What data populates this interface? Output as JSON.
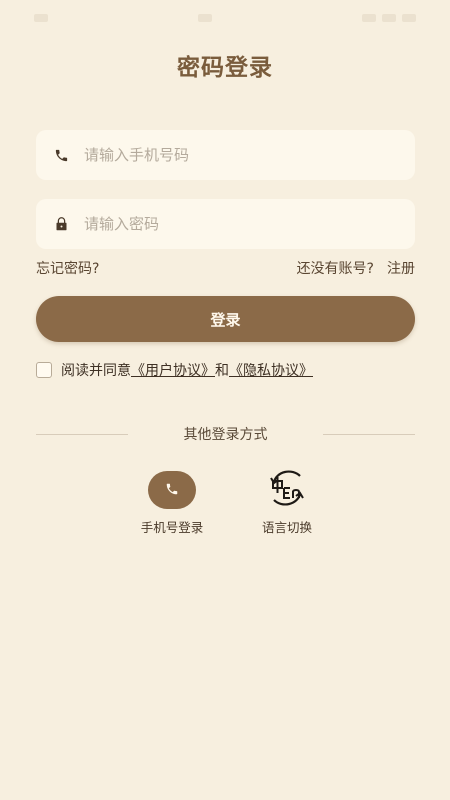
{
  "page": {
    "title": "密码登录"
  },
  "form": {
    "phone_placeholder": "请输入手机号码",
    "password_placeholder": "请输入密码",
    "forgot_password": "忘记密码?",
    "no_account": "还没有账号?",
    "register": "注册",
    "login_button": "登录"
  },
  "agreement": {
    "prefix": "阅读并同意",
    "user_agreement": "《用户协议》",
    "conjunction": "和",
    "privacy_agreement": "《隐私协议》"
  },
  "other_login": {
    "title": "其他登录方式",
    "options": [
      {
        "label": "手机号登录",
        "icon": "phone-icon"
      },
      {
        "label": "语言切换",
        "icon": "language-switch-icon"
      }
    ]
  },
  "colors": {
    "background": "#f7efdf",
    "accent": "#8b6a48",
    "title": "#7a5c3c"
  }
}
